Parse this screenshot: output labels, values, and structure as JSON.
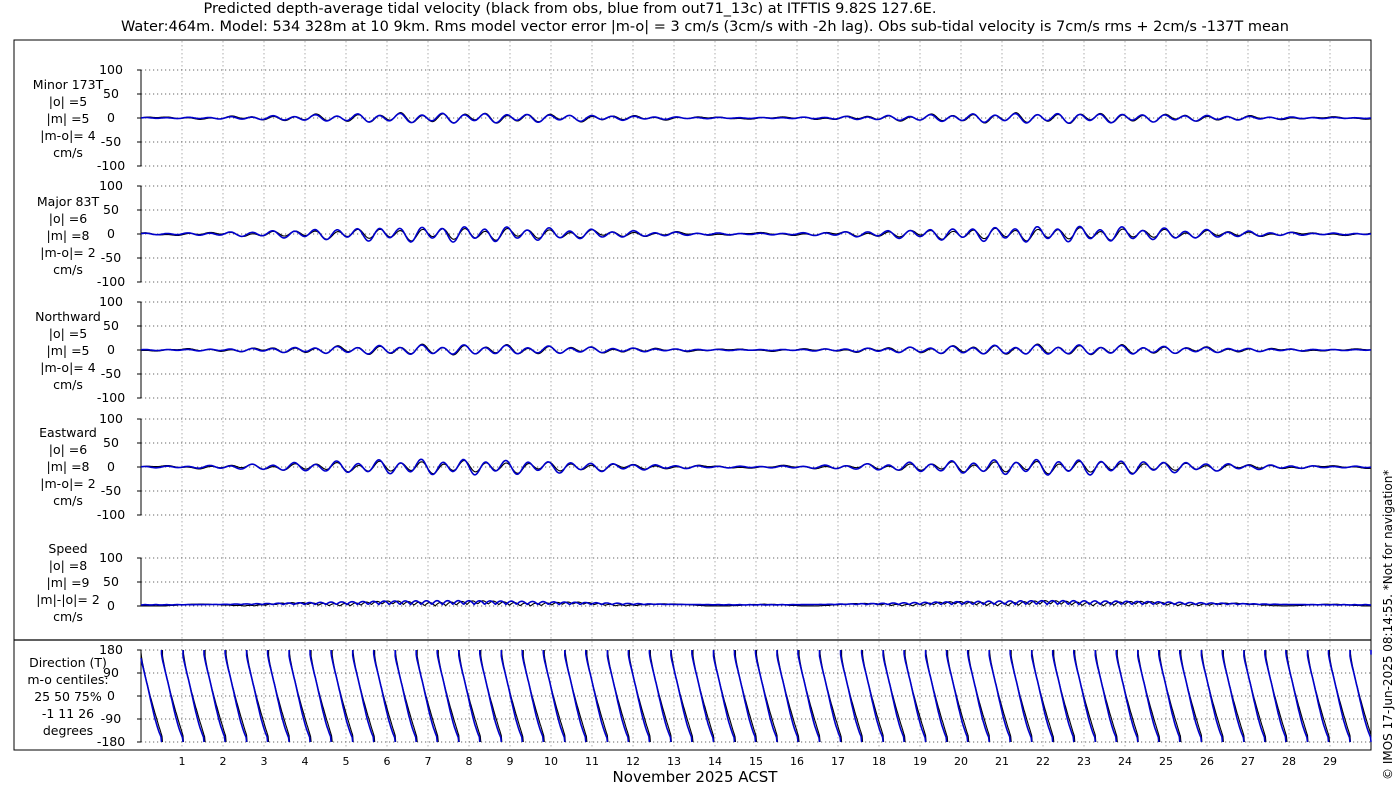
{
  "title_line1": "Predicted depth-average tidal velocity (black from obs, blue from out71_13c) at ITFTIS 9.82S 127.6E.",
  "title_line2": "Water:464m. Model: 534 328m at 10 9km. Rms model vector error |m-o| = 3 cm/s (3cm/s with -2h lag). Obs sub-tidal velocity is 7cm/s rms + 2cm/s -137T mean",
  "copyright": "© IMOS 17-Jun-2025 08:14:55. *Not for navigation*",
  "colors": {
    "obs": "#000000",
    "model": "#0000cc",
    "grid": "#9a9a9a"
  },
  "panels": [
    {
      "id": "minor",
      "lines": [
        "Minor 173T",
        "|o| =5",
        "|m| =5",
        "|m-o|= 4",
        "cm/s"
      ]
    },
    {
      "id": "major",
      "lines": [
        "Major 83T",
        "|o| =6",
        "|m| =8",
        "|m-o|= 2",
        "cm/s"
      ]
    },
    {
      "id": "north",
      "lines": [
        "Northward",
        "|o| =5",
        "|m| =5",
        "|m-o|= 4",
        "cm/s"
      ]
    },
    {
      "id": "east",
      "lines": [
        "Eastward",
        "|o| =6",
        "|m| =8",
        "|m-o|= 2",
        "cm/s"
      ]
    },
    {
      "id": "speed",
      "lines": [
        "Speed",
        "|o| =8",
        "|m| =9",
        "|m|-|o|= 2",
        "cm/s"
      ]
    },
    {
      "id": "direction",
      "lines": [
        "Direction (T)",
        "m-o centiles:",
        "25  50  75%",
        "-1  11  26",
        "degrees"
      ]
    }
  ],
  "chart_data": {
    "type": "line",
    "xlabel": "November 2025 ACST",
    "x_ticks": [
      "1",
      "2",
      "3",
      "4",
      "5",
      "6",
      "7",
      "8",
      "9",
      "10",
      "11",
      "12",
      "13",
      "14",
      "15",
      "16",
      "17",
      "18",
      "19",
      "20",
      "21",
      "22",
      "23",
      "24",
      "25",
      "26",
      "27",
      "28",
      "29"
    ],
    "xlim_days": [
      0.0,
      30.0
    ],
    "grid": true,
    "subplots": [
      {
        "name": "Minor 173T",
        "ylim": [
          -100,
          100
        ],
        "yticks": [
          "100",
          "50",
          "0",
          "-50",
          "-100"
        ],
        "series": [
          {
            "name": "obs",
            "amplitude": 5
          },
          {
            "name": "model",
            "amplitude": 5
          }
        ]
      },
      {
        "name": "Major 83T",
        "ylim": [
          -100,
          100
        ],
        "yticks": [
          "100",
          "50",
          "0",
          "-50",
          "-100"
        ],
        "series": [
          {
            "name": "obs",
            "amplitude": 6
          },
          {
            "name": "model",
            "amplitude": 8
          }
        ]
      },
      {
        "name": "Northward",
        "ylim": [
          -100,
          100
        ],
        "yticks": [
          "100",
          "50",
          "0",
          "-50",
          "-100"
        ],
        "series": [
          {
            "name": "obs",
            "amplitude": 5
          },
          {
            "name": "model",
            "amplitude": 5
          }
        ]
      },
      {
        "name": "Eastward",
        "ylim": [
          -100,
          100
        ],
        "yticks": [
          "100",
          "50",
          "0",
          "-50",
          "-100"
        ],
        "series": [
          {
            "name": "obs",
            "amplitude": 6
          },
          {
            "name": "model",
            "amplitude": 8
          }
        ]
      },
      {
        "name": "Speed",
        "ylim": [
          0,
          100
        ],
        "yticks": [
          "100",
          "50",
          "0"
        ],
        "series": [
          {
            "name": "obs",
            "amplitude": 8
          },
          {
            "name": "model",
            "amplitude": 9
          }
        ]
      },
      {
        "name": "Direction (T)",
        "ylim": [
          -180,
          180
        ],
        "yticks": [
          "180",
          "90",
          "0",
          "-90",
          "-180"
        ],
        "series": [
          {
            "name": "obs"
          },
          {
            "name": "model"
          }
        ]
      }
    ]
  }
}
